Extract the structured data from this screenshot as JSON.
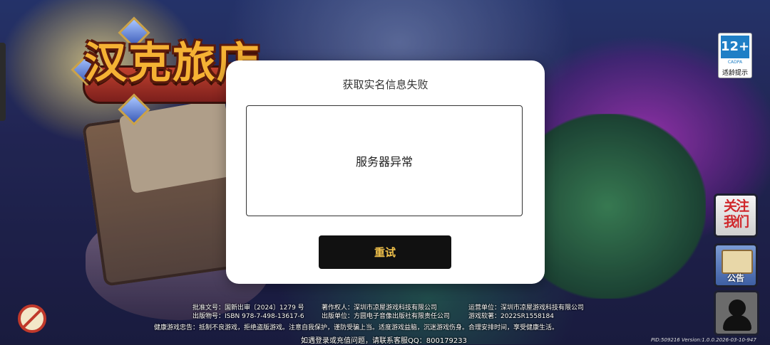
{
  "game": {
    "logo_text": "汉克旅店"
  },
  "dialog": {
    "title": "获取实名信息失败",
    "message": "服务器异常",
    "retry_label": "重试"
  },
  "age_badge": {
    "rating": "12+",
    "org": "CADPA",
    "caption": "适龄提示"
  },
  "side_buttons": {
    "about_label": "关注我们",
    "notice_label": "公告"
  },
  "footer": {
    "approval": "批准文号：国新出审〔2024〕1279 号",
    "copyright": "著作权人：深圳市凉屋游戏科技有限公司",
    "operator": "运营单位：深圳市凉屋游戏科技有限公司",
    "isbn": "出版物号：ISBN 978-7-498-13617-6",
    "publisher": "出版单位：方圆电子音像出版社有限责任公司",
    "software": "游戏软著：2022SR1558184",
    "health": "健康游戏忠告：抵制不良游戏，拒绝盗版游戏。注意自我保护，谨防受骗上当。适度游戏益脑，沉迷游戏伤身。合理安排时间，享受健康生活。",
    "contact": "如遇登录或充值问题，请联系客服QQ：800179233",
    "version": "PID:509216  Version:1.0.0.2026-03-10-947"
  }
}
